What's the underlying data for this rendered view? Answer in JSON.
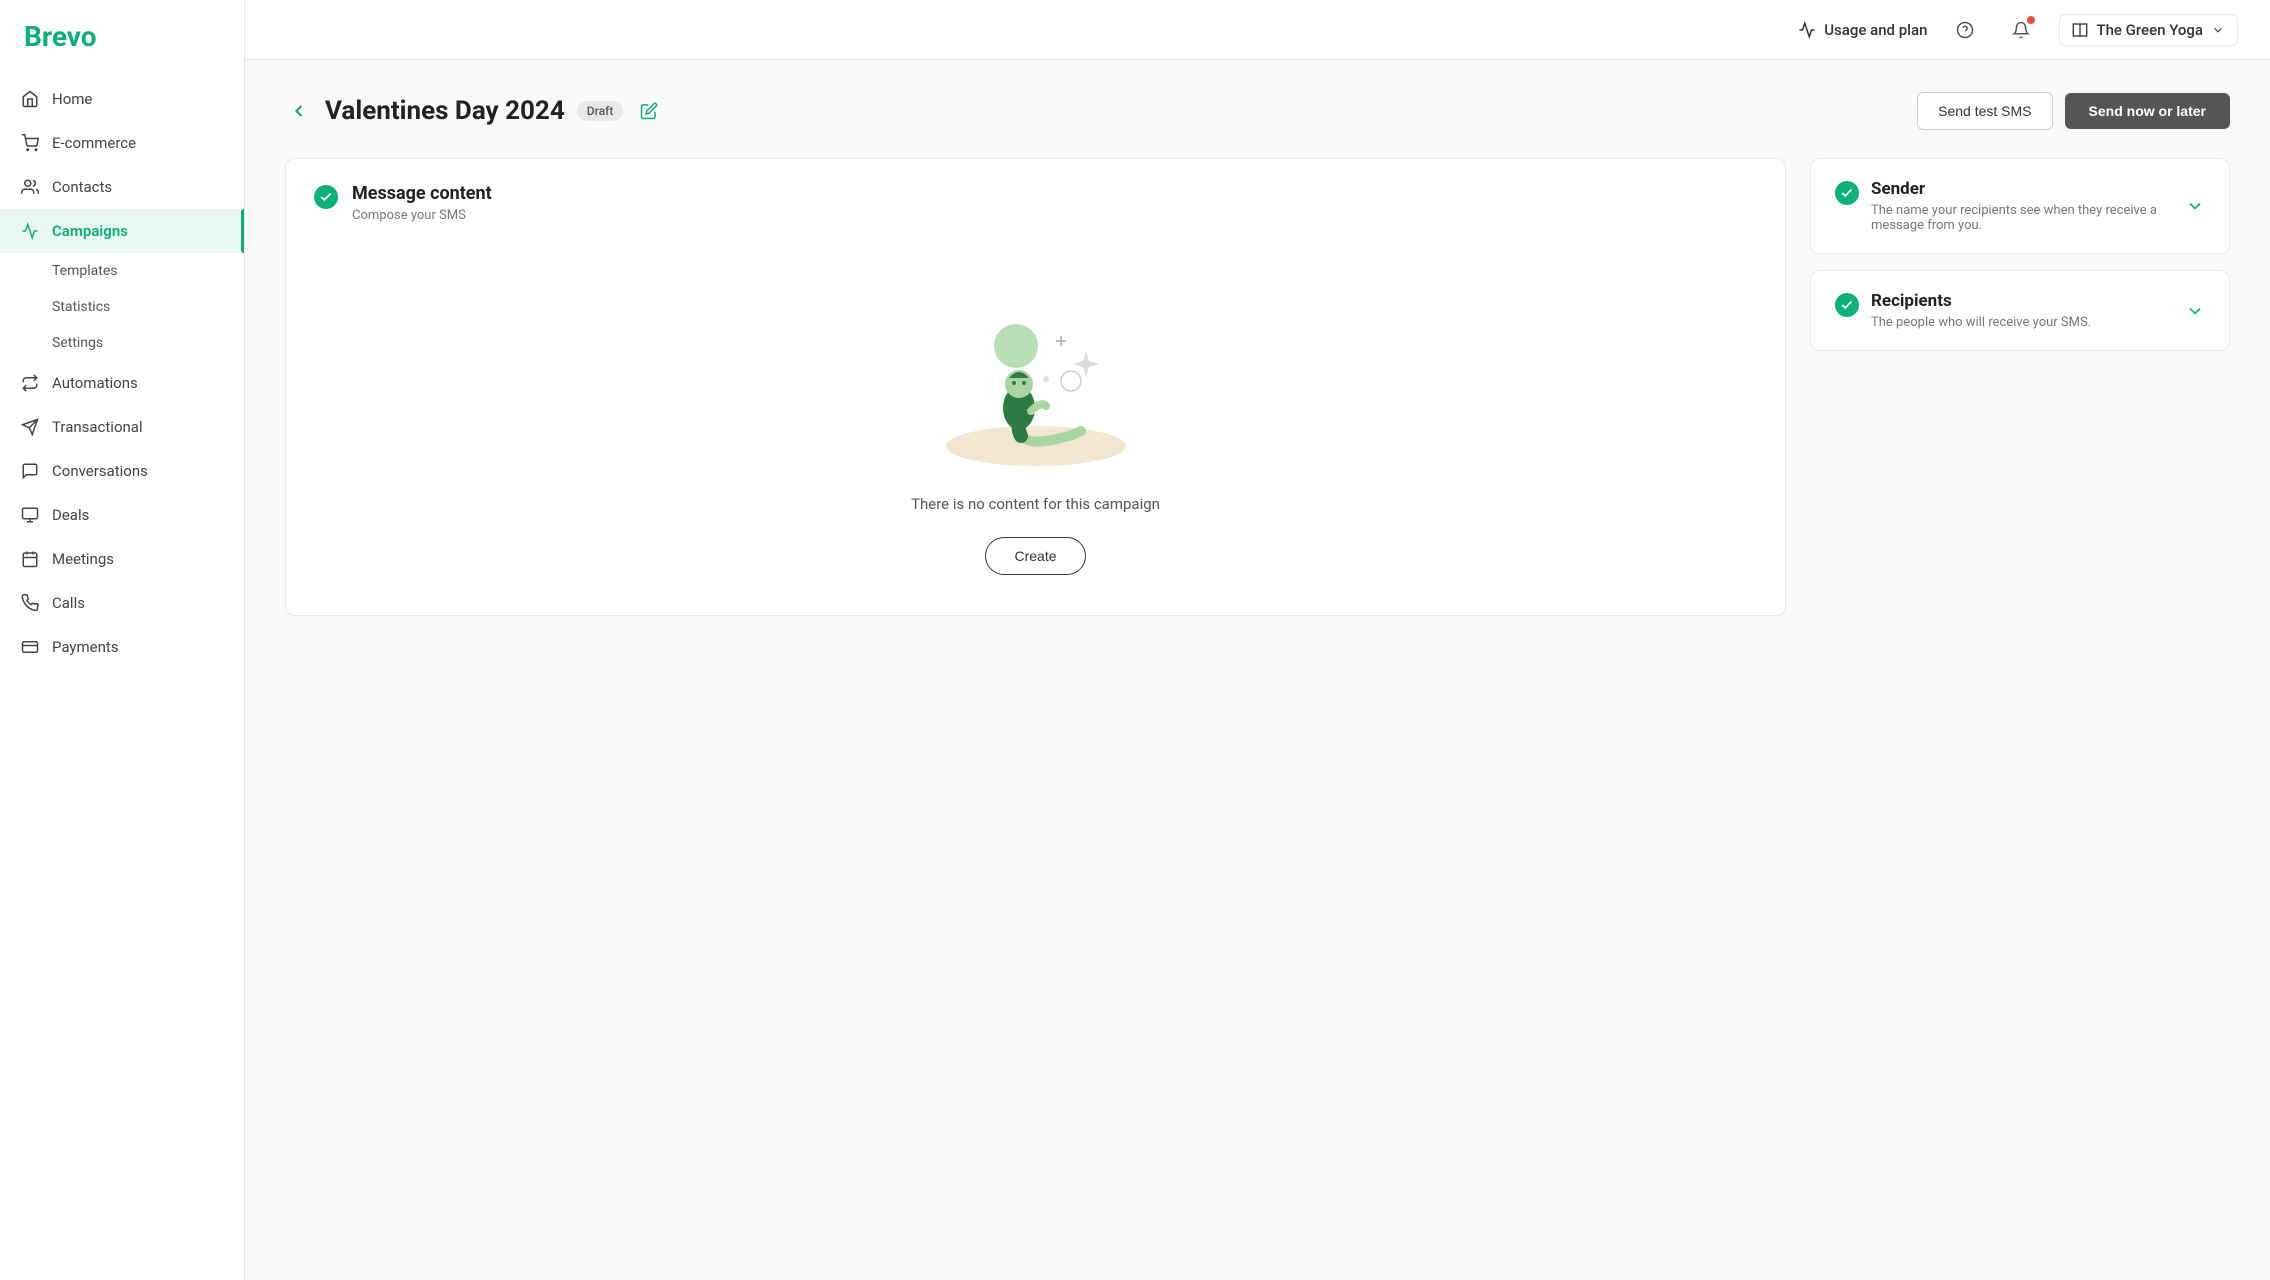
{
  "brand": {
    "name": "Brevo",
    "color": "#0bb07b"
  },
  "header": {
    "usage_label": "Usage and plan",
    "org_name": "The Green Yoga",
    "help_icon": "help-icon",
    "notification_icon": "notification-icon",
    "chevron_icon": "chevron-down-icon",
    "org_icon": "building-icon"
  },
  "sidebar": {
    "items": [
      {
        "id": "home",
        "label": "Home",
        "icon": "home-icon",
        "active": false
      },
      {
        "id": "ecommerce",
        "label": "E-commerce",
        "icon": "ecommerce-icon",
        "active": false
      },
      {
        "id": "contacts",
        "label": "Contacts",
        "icon": "contacts-icon",
        "active": false
      },
      {
        "id": "campaigns",
        "label": "Campaigns",
        "icon": "campaigns-icon",
        "active": true
      },
      {
        "id": "automations",
        "label": "Automations",
        "icon": "automations-icon",
        "active": false
      },
      {
        "id": "transactional",
        "label": "Transactional",
        "icon": "transactional-icon",
        "active": false
      },
      {
        "id": "conversations",
        "label": "Conversations",
        "icon": "conversations-icon",
        "active": false
      },
      {
        "id": "deals",
        "label": "Deals",
        "icon": "deals-icon",
        "active": false
      },
      {
        "id": "meetings",
        "label": "Meetings",
        "icon": "meetings-icon",
        "active": false
      },
      {
        "id": "calls",
        "label": "Calls",
        "icon": "calls-icon",
        "active": false
      },
      {
        "id": "payments",
        "label": "Payments",
        "icon": "payments-icon",
        "active": false
      }
    ],
    "sub_items": [
      {
        "id": "templates",
        "label": "Templates",
        "active": false
      },
      {
        "id": "statistics",
        "label": "Statistics",
        "active": false
      },
      {
        "id": "settings",
        "label": "Settings",
        "active": false
      }
    ]
  },
  "page": {
    "title": "Valentines Day 2024",
    "badge": "Draft",
    "back_icon": "back-icon",
    "edit_icon": "edit-icon"
  },
  "actions": {
    "send_test_sms": "Send test SMS",
    "send_now_or_later": "Send now or later"
  },
  "message_content": {
    "title": "Message content",
    "subtitle": "Compose your SMS",
    "empty_text": "There is no content for this campaign",
    "create_btn": "Create"
  },
  "sender": {
    "title": "Sender",
    "subtitle": "The name your recipients see when they receive a message from you."
  },
  "recipients": {
    "title": "Recipients",
    "subtitle": "The people who will receive your SMS."
  }
}
